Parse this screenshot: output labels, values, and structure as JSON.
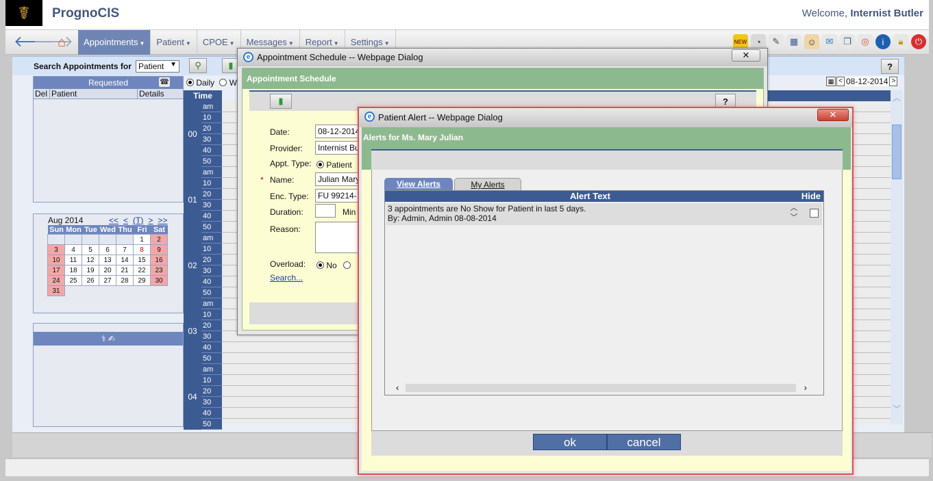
{
  "header": {
    "brand": "PrognoCIS",
    "welcome_prefix": "Welcome,",
    "user_name": "Internist Butler"
  },
  "nav": {
    "menus": [
      {
        "label": "Appointments",
        "active": true
      },
      {
        "label": "Patient"
      },
      {
        "label": "CPOE"
      },
      {
        "label": "Messages"
      },
      {
        "label": "Report"
      },
      {
        "label": "Settings"
      }
    ],
    "new_badge": "NEW"
  },
  "search": {
    "label": "Search Appointments for",
    "type_value": "Patient",
    "help": "?"
  },
  "requested": {
    "title": "Requested",
    "cols": [
      "Del",
      "Patient",
      "Details"
    ]
  },
  "calendar": {
    "month": "Aug 2014",
    "nav": [
      "<<",
      "<",
      "(T)",
      ">",
      ">>"
    ],
    "day_names": [
      "Sun",
      "Mon",
      "Tue",
      "Wed",
      "Thu",
      "Fri",
      "Sat"
    ],
    "leading_blanks": 5,
    "days": 31,
    "red_days": [
      8
    ]
  },
  "schedule": {
    "views": [
      {
        "label": "Daily",
        "selected": true
      },
      {
        "label": "W"
      }
    ],
    "time_header": "Time",
    "hours": [
      "00",
      "01",
      "02",
      "03",
      "04"
    ],
    "minutes": [
      "am",
      "10",
      "20",
      "30",
      "40",
      "50"
    ],
    "last_partial": "50",
    "date": "08-12-2014"
  },
  "dialog1": {
    "title": "Appointment Schedule -- Webpage Dialog",
    "heading": "Appointment Schedule",
    "help": "?",
    "close": "✕",
    "fields": {
      "date_label": "Date:",
      "date_value": "08-12-2014",
      "provider_label": "Provider:",
      "provider_value": "Internist Bu",
      "appt_type_label": "Appt. Type:",
      "appt_type_value": "Patient",
      "required_mark": "*",
      "name_label": "Name:",
      "name_value": "Julian Mary",
      "enc_type_label": "Enc. Type:",
      "enc_type_value": "FU 99214-",
      "duration_label": "Duration:",
      "duration_suffix": "Min",
      "reason_label": "Reason:",
      "overload_label": "Overload:",
      "overload_no": "No",
      "search_link": "Search..."
    }
  },
  "dialog2": {
    "title": "Patient Alert -- Webpage Dialog",
    "close": "✕",
    "heading": "Alerts for Ms. Mary Julian",
    "tabs": [
      {
        "label": "View Alerts",
        "active": true
      },
      {
        "label": "My Alerts"
      }
    ],
    "table": {
      "col_alert": "Alert Text",
      "col_hide": "Hide"
    },
    "alerts": [
      {
        "line1": "3 appointments are No Show for Patient in last 5 days.",
        "line2": "By: Admin, Admin 08-08-2014"
      }
    ],
    "ok": "ok",
    "cancel": "cancel"
  }
}
